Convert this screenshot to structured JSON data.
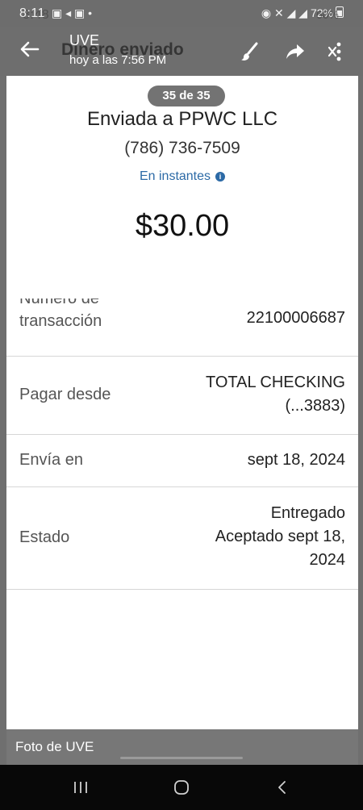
{
  "status_bar": {
    "time": "8:11",
    "time_ghost": "8:48",
    "battery": "72%",
    "battery_ghost": "60%"
  },
  "top_bar": {
    "title": "Dinero enviado",
    "overlay_name": "UVE",
    "overlay_subtitle": "hoy a las 7:56 PM",
    "back_icon": "arrow-left-icon",
    "edit_icon": "brush-icon",
    "share_icon": "share-icon",
    "more_icon": "more-vertical-icon"
  },
  "transaction": {
    "counter": "35 de 35",
    "sent_to": "Enviada a PPWC LLC",
    "phone": "(786) 736-7509",
    "speed": "En instantes",
    "amount": "$30.00"
  },
  "details": {
    "transaction_number_label_top": "Número de",
    "transaction_number_label_bottom": "transacción",
    "transaction_number": "22100006687",
    "pay_from_label": "Pagar desde",
    "pay_from_line1": "TOTAL CHECKING",
    "pay_from_line2": "(...3883)",
    "send_on_label": "Envía en",
    "send_on": "sept 18, 2024",
    "status_label": "Estado",
    "status_line1": "Entregado",
    "status_line2": "Aceptado sept 18,",
    "status_line3": "2024"
  },
  "caption": {
    "text": "Foto de UVE"
  },
  "colors": {
    "link_blue": "#2c6aa6",
    "chrome_gray": "#6e6e6e",
    "nav_black": "#080808"
  }
}
